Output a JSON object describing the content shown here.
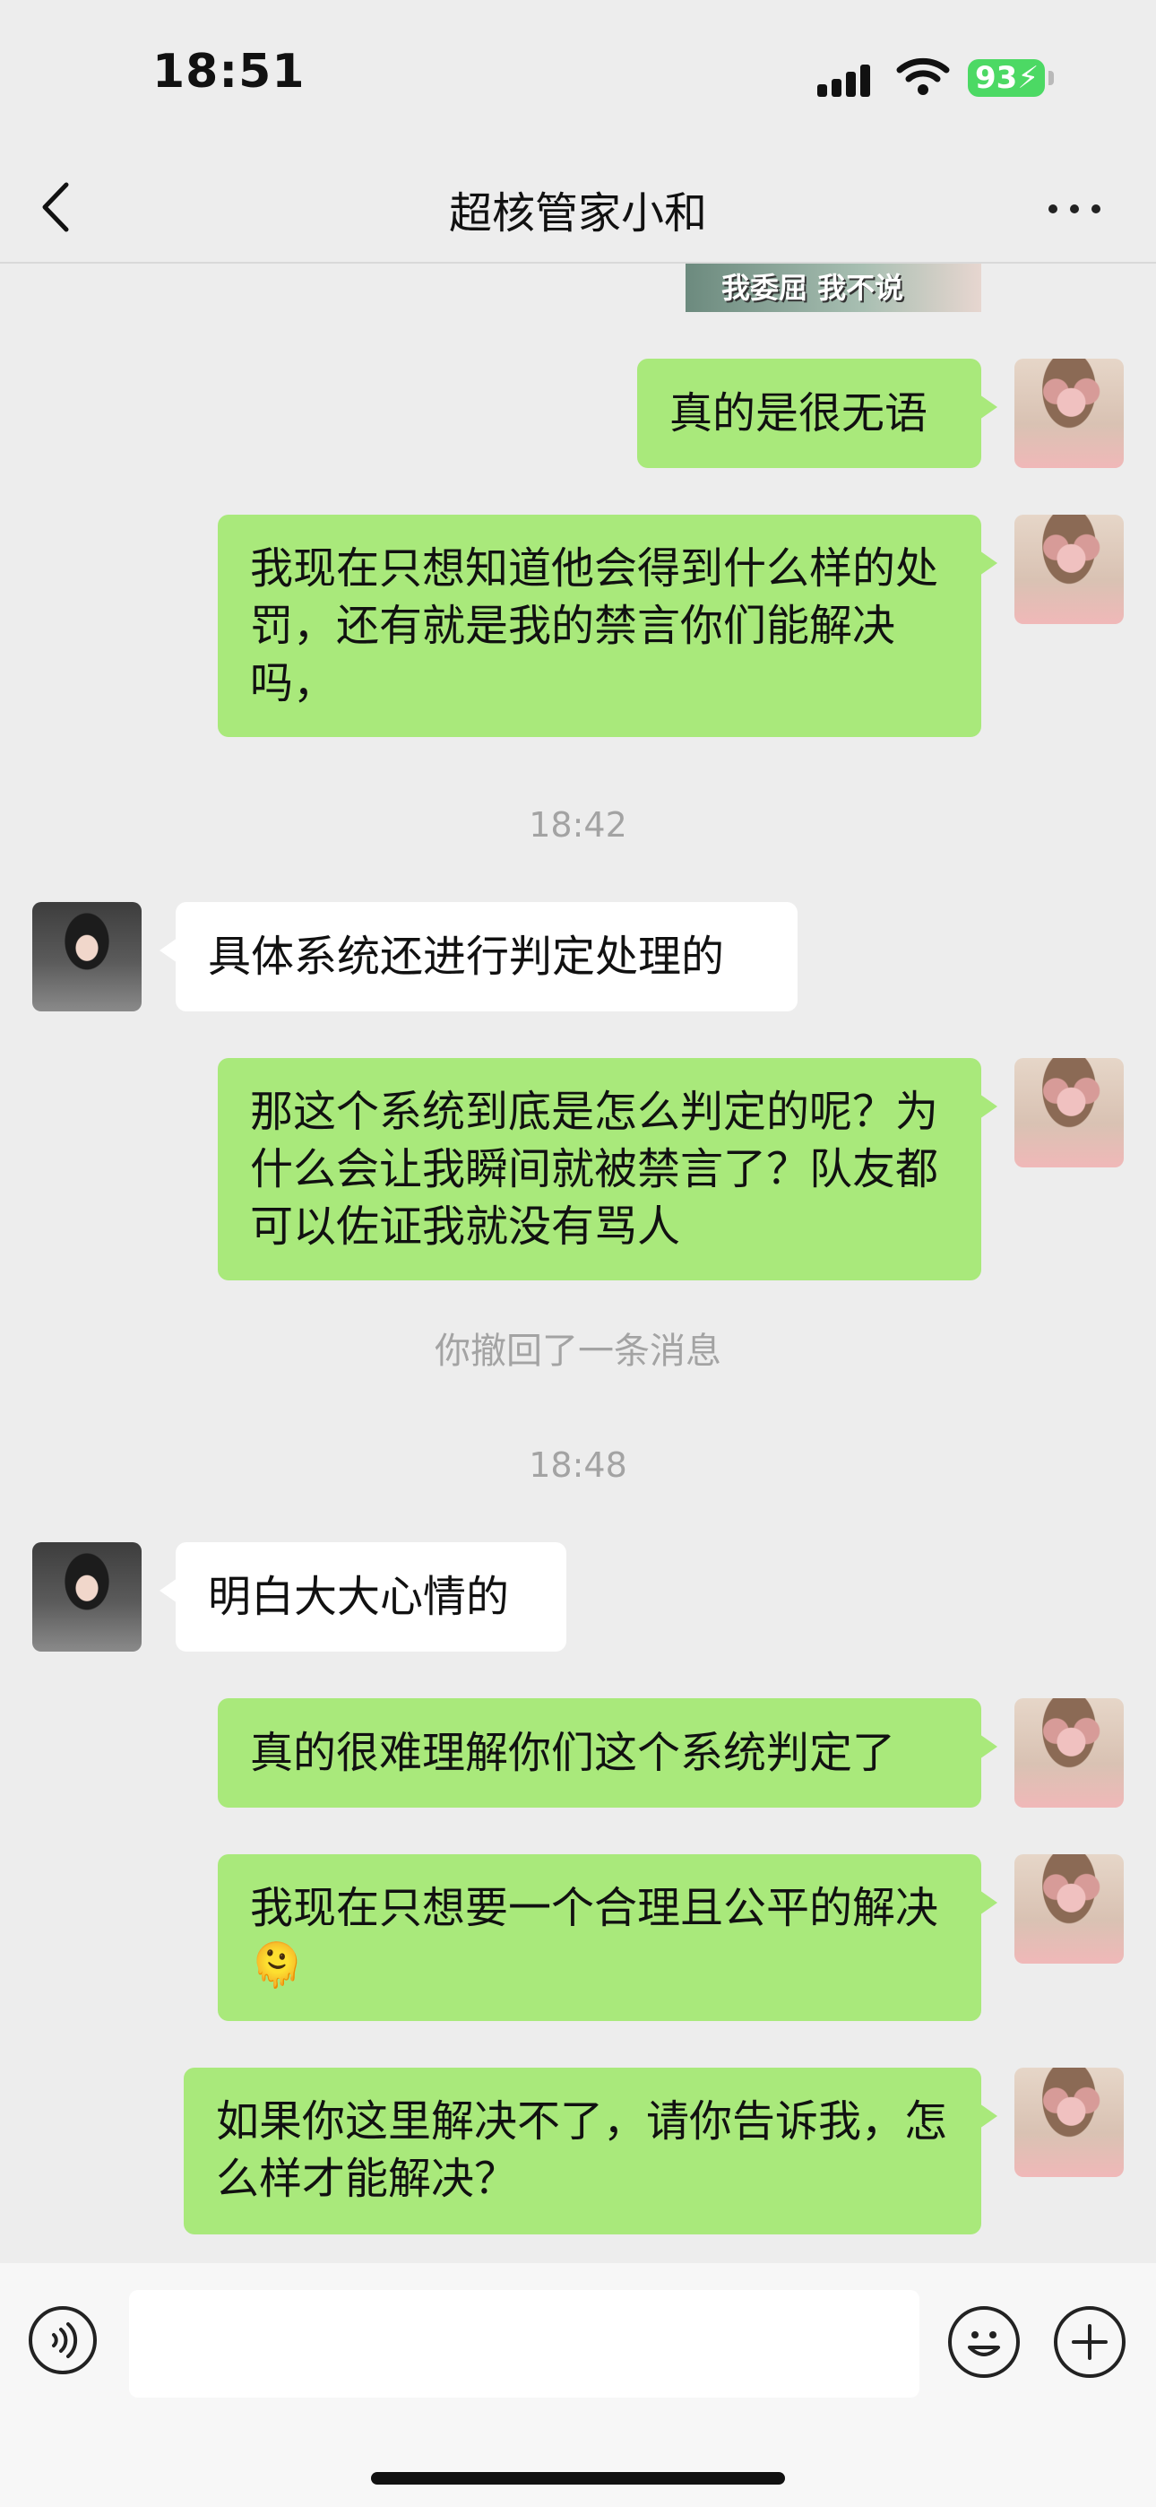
{
  "status_bar": {
    "time": "18:51",
    "battery": "93"
  },
  "nav": {
    "title": "超核管家小和",
    "back_icon": "chevron-left-icon",
    "more_icon": "more-dots-icon"
  },
  "chat": {
    "sticker_caption": "我委屈 我不说",
    "messages": [
      {
        "from": "me",
        "text": "真的是很无语"
      },
      {
        "from": "me",
        "text": "我现在只想知道他会得到什么样的处罚，还有就是我的禁言你们能解决吗，"
      },
      {
        "type": "time",
        "text": "18:42"
      },
      {
        "from": "other",
        "text": "具体系统还进行判定处理的"
      },
      {
        "from": "me",
        "text": "那这个系统到底是怎么判定的呢？为什么会让我瞬间就被禁言了？队友都可以佐证我就没有骂人"
      },
      {
        "type": "system",
        "text": "你撤回了一条消息"
      },
      {
        "type": "time",
        "text": "18:48"
      },
      {
        "from": "other",
        "text": "明白大大心情的"
      },
      {
        "from": "me",
        "text": "真的很难理解你们这个系统判定了"
      },
      {
        "from": "me",
        "text": "我现在只想要一个合理且公平的解决🫠"
      },
      {
        "from": "me",
        "text": "如果你这里解决不了，请你告诉我，怎么样才能解决？"
      }
    ]
  },
  "input_bar": {
    "voice_icon": "voice-icon",
    "emoji_icon": "emoji-icon",
    "plus_icon": "plus-icon",
    "input_value": ""
  }
}
